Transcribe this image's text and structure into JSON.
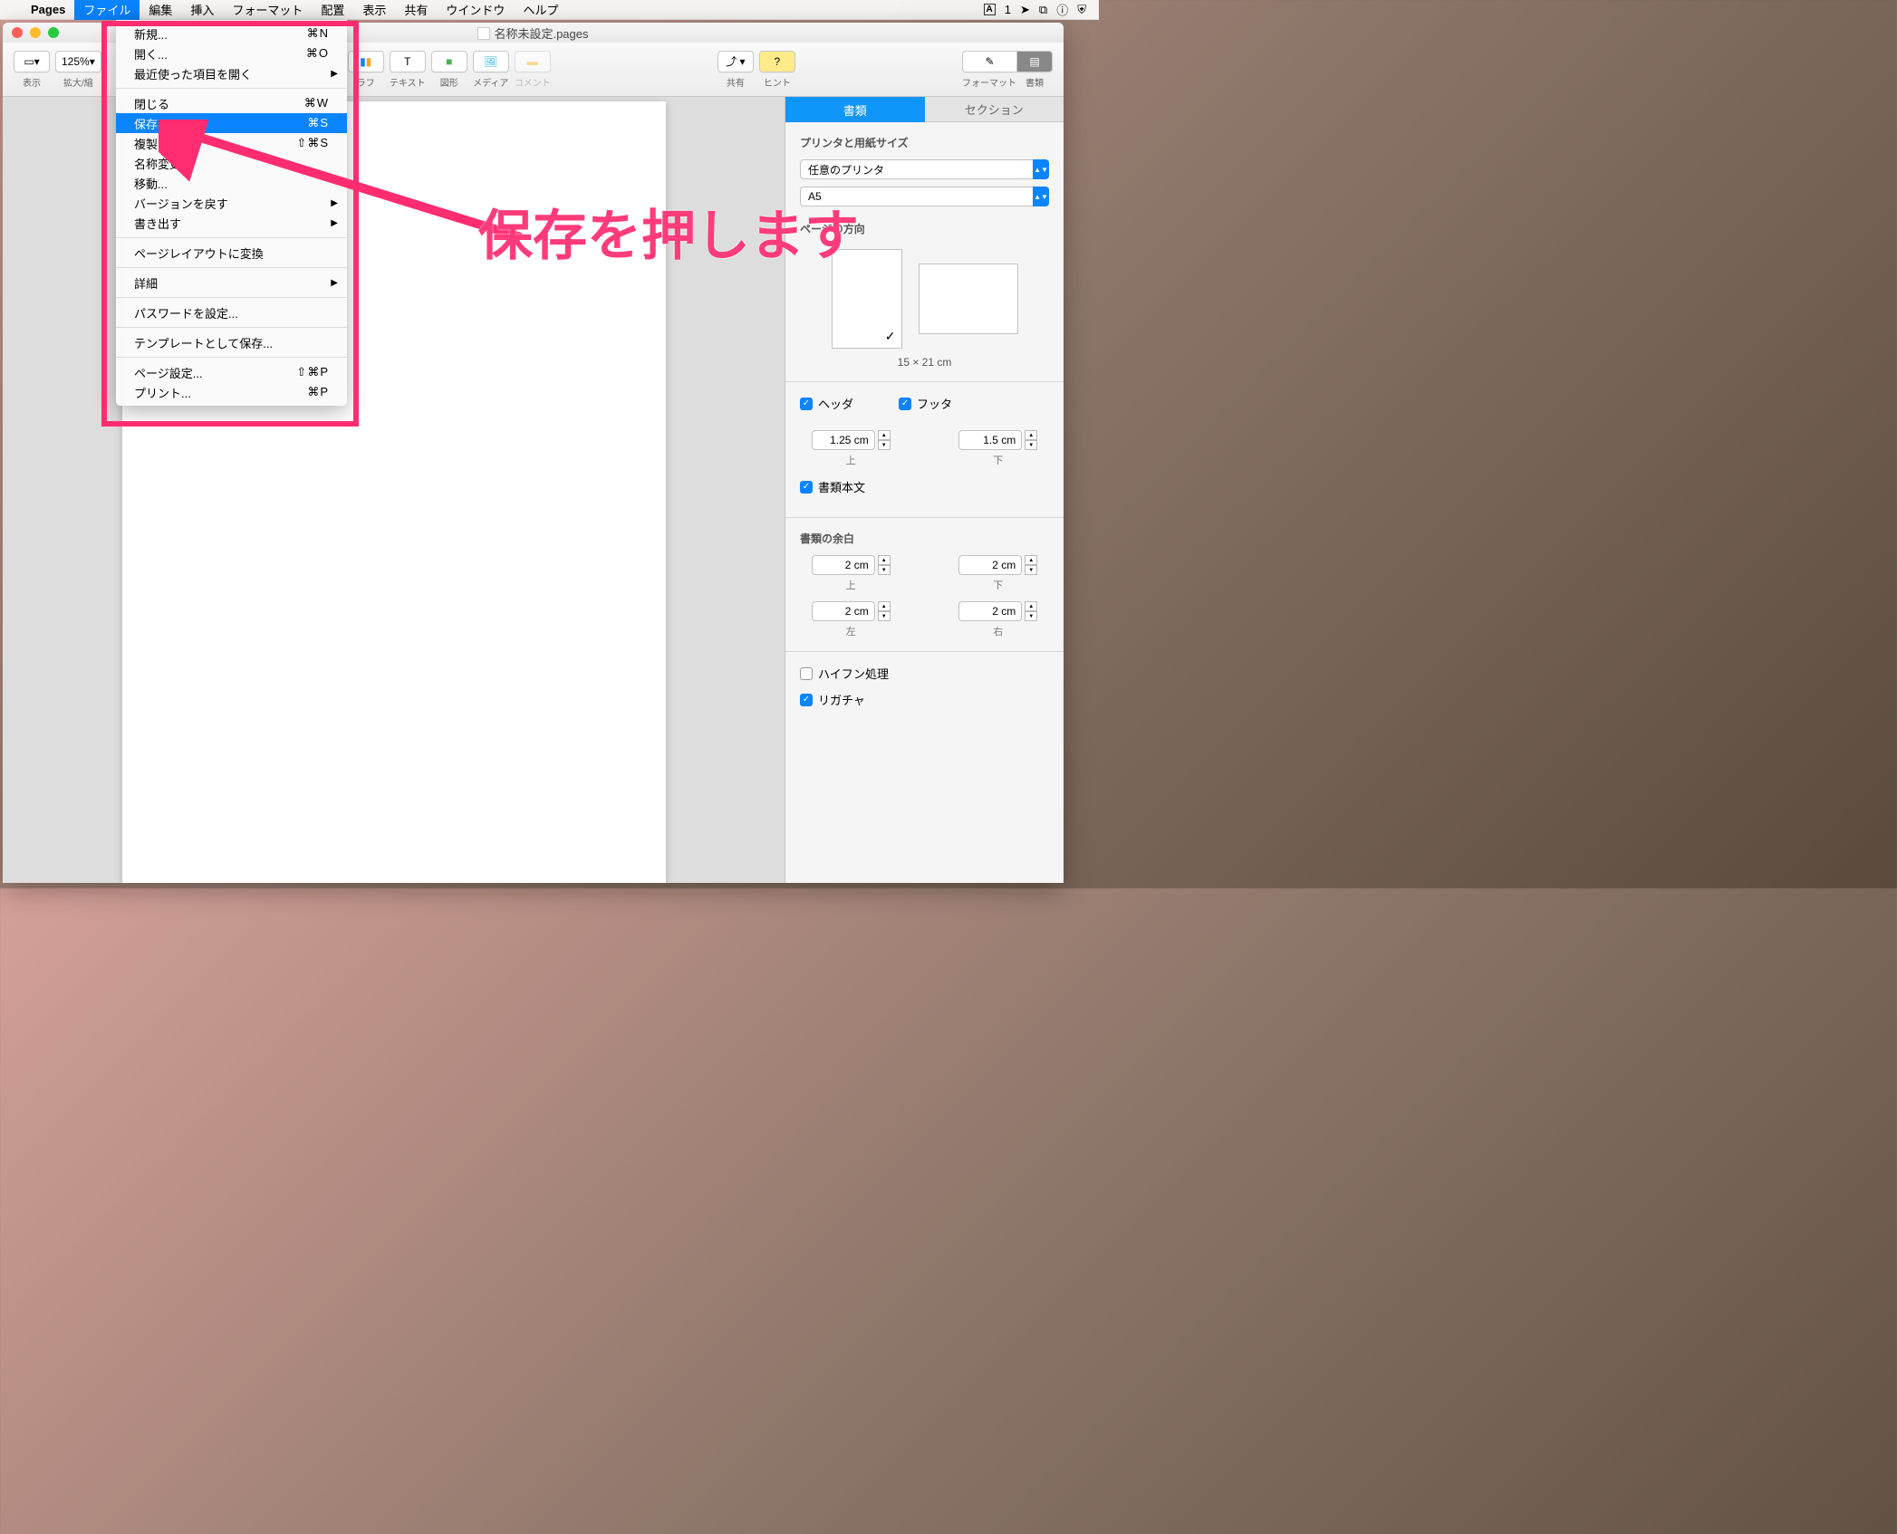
{
  "menubar": {
    "app": "Pages",
    "items": [
      "ファイル",
      "編集",
      "挿入",
      "フォーマット",
      "配置",
      "表示",
      "共有",
      "ウインドウ",
      "ヘルプ"
    ],
    "right_badge": "1"
  },
  "window": {
    "title": "名称未設定.pages"
  },
  "toolbar": {
    "view": "表示",
    "zoom_value": "125%",
    "zoom_label": "拡大/縮",
    "chart": "ラフ",
    "text": "テキスト",
    "shape": "図形",
    "media": "メディア",
    "comment": "コメント",
    "share": "共有",
    "hint": "ヒント",
    "format": "フォーマット",
    "document": "書類"
  },
  "dropdown": {
    "items": [
      {
        "label": "新規...",
        "shortcut": "⌘N"
      },
      {
        "label": "開く...",
        "shortcut": "⌘O"
      },
      {
        "label": "最近使った項目を開く",
        "submenu": true
      },
      {
        "sep": true
      },
      {
        "label": "閉じる",
        "shortcut": "⌘W"
      },
      {
        "label": "保存",
        "shortcut": "⌘S",
        "highlighted": true
      },
      {
        "label": "複製",
        "shortcut": "⇧⌘S"
      },
      {
        "label": "名称変更..."
      },
      {
        "label": "移動..."
      },
      {
        "label": "バージョンを戻す",
        "submenu": true
      },
      {
        "label": "書き出す",
        "submenu": true
      },
      {
        "sep": true
      },
      {
        "label": "ページレイアウトに変換"
      },
      {
        "sep": true
      },
      {
        "label": "詳細",
        "submenu": true
      },
      {
        "sep": true
      },
      {
        "label": "パスワードを設定..."
      },
      {
        "sep": true
      },
      {
        "label": "テンプレートとして保存..."
      },
      {
        "sep": true
      },
      {
        "label": "ページ設定...",
        "shortcut": "⇧⌘P"
      },
      {
        "label": "プリント...",
        "shortcut": "⌘P"
      }
    ]
  },
  "inspector": {
    "tabs": {
      "document": "書類",
      "section": "セクション"
    },
    "printer_heading": "プリンタと用紙サイズ",
    "printer_select": "任意のプリンタ",
    "paper_select": "A5",
    "orientation_heading": "ページの方向",
    "dimensions": "15 × 21 cm",
    "header_check": "ヘッダ",
    "footer_check": "フッタ",
    "header_val": "1.25 cm",
    "footer_val": "1.5 cm",
    "top_label": "上",
    "bottom_label": "下",
    "left_label": "左",
    "right_label": "右",
    "body_check": "書類本文",
    "margins_heading": "書類の余白",
    "margin_top": "2 cm",
    "margin_bottom": "2 cm",
    "margin_left": "2 cm",
    "margin_right": "2 cm",
    "hyphen_check": "ハイフン処理",
    "ligature_check": "リガチャ"
  },
  "annotation": {
    "text": "保存を押します"
  }
}
